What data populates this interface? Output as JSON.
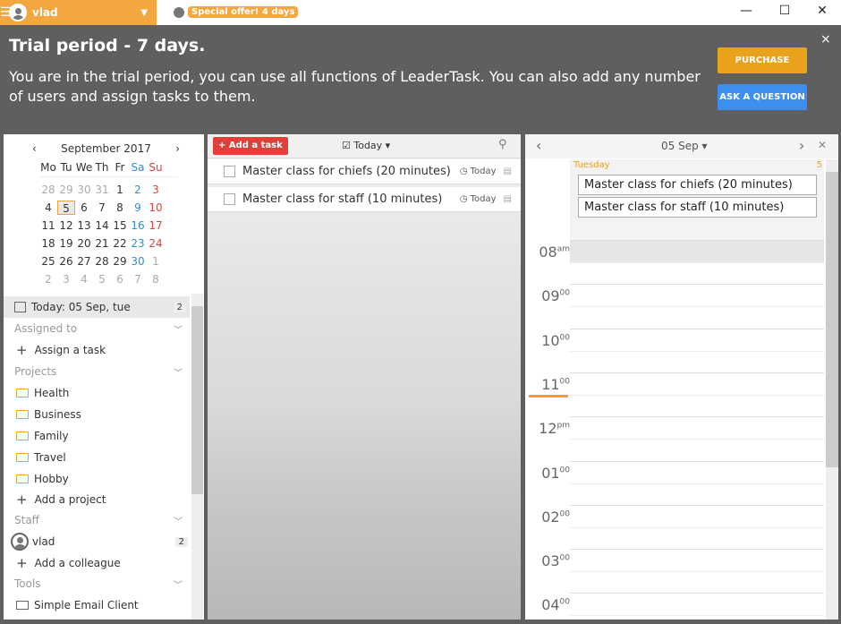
{
  "topbar": {
    "user": "vlad",
    "offer": "Special offer! 4 days",
    "minimize": "—",
    "maximize": "☐",
    "close": "✕"
  },
  "banner": {
    "title": "Trial period - 7 days.",
    "text": "You are in the trial period, you can use all functions of LeaderTask. You can also add any number of users and assign tasks to them.",
    "purchase": "PURCHASE",
    "ask": "ASK A QUESTION",
    "close": "×",
    "purchase_color": "#e8a21c",
    "ask_color": "#3d8fef"
  },
  "calendar": {
    "month": "September 2017",
    "weekdays": [
      "Mo",
      "Tu",
      "We",
      "Th",
      "Fr",
      "Sa",
      "Su"
    ],
    "days": [
      "28",
      "29",
      "30",
      "31",
      "1",
      "2",
      "3",
      "4",
      "5",
      "6",
      "7",
      "8",
      "9",
      "10",
      "11",
      "12",
      "13",
      "14",
      "15",
      "16",
      "17",
      "18",
      "19",
      "20",
      "21",
      "22",
      "23",
      "24",
      "25",
      "26",
      "27",
      "28",
      "29",
      "30",
      "1",
      "2",
      "3",
      "4",
      "5",
      "6",
      "7",
      "8"
    ],
    "selected": "5"
  },
  "sidebar": {
    "today": "Today: 05 Sep, tue",
    "today_count": "2",
    "assigned": "Assigned to",
    "assign": "Assign a task",
    "projects": "Projects",
    "project_items": [
      "Health",
      "Business",
      "Family",
      "Travel",
      "Hobby"
    ],
    "add_project": "Add a project",
    "staff": "Staff",
    "staff_user": "vlad",
    "staff_count": "2",
    "add_colleague": "Add a colleague",
    "tools": "Tools",
    "email": "Simple Email Client"
  },
  "tasks": {
    "add": "Add a task",
    "filter": "Today",
    "items": [
      {
        "title": "Master class for chiefs (20 minutes)",
        "due": "Today"
      },
      {
        "title": "Master class for staff (10 minutes)",
        "due": "Today"
      }
    ]
  },
  "day": {
    "date": "05 Sep",
    "weekday": "Tuesday",
    "daynum": "5",
    "events": [
      "Master class for chiefs (20 minutes)",
      "Master class for staff (10 minutes)"
    ],
    "hours": [
      {
        "h": "08",
        "s": "am"
      },
      {
        "h": "09",
        "s": "00"
      },
      {
        "h": "10",
        "s": "00"
      },
      {
        "h": "11",
        "s": "00"
      },
      {
        "h": "12",
        "s": "pm"
      },
      {
        "h": "01",
        "s": "00"
      },
      {
        "h": "02",
        "s": "00"
      },
      {
        "h": "03",
        "s": "00"
      },
      {
        "h": "04",
        "s": "00"
      }
    ],
    "current_time": "11:00"
  }
}
